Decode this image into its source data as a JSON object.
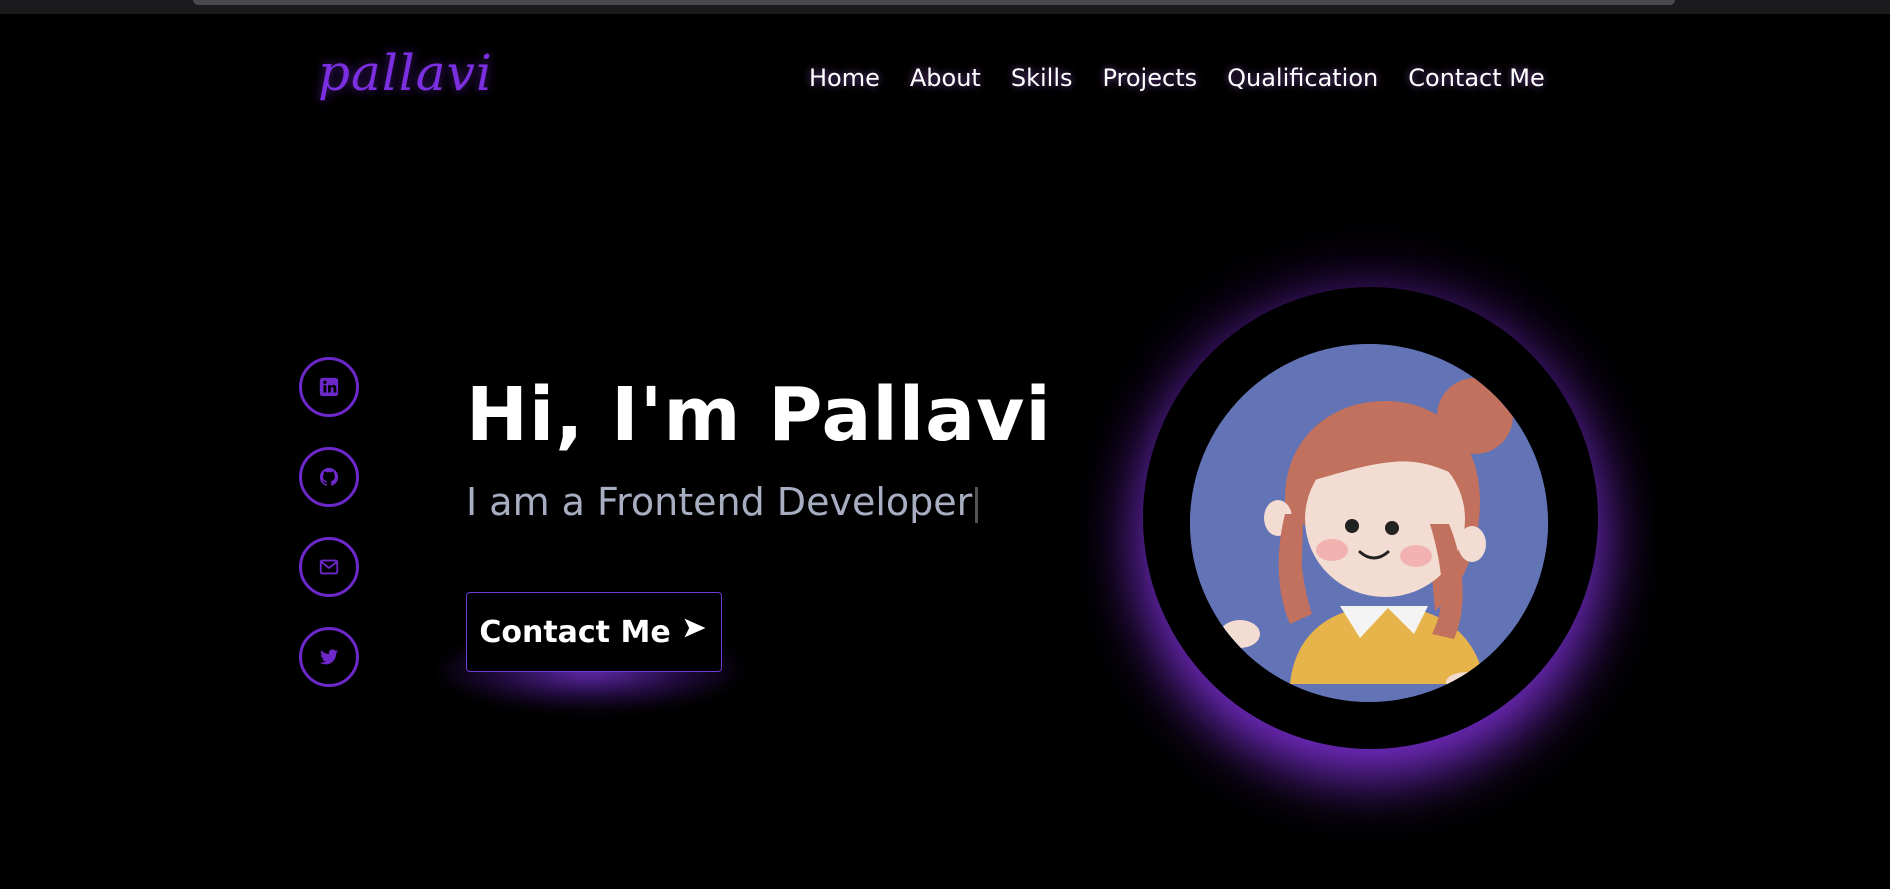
{
  "brand": {
    "logo_text": "pallavi",
    "accent_color": "#6d28c9"
  },
  "nav": {
    "items": [
      {
        "label": "Home"
      },
      {
        "label": "About"
      },
      {
        "label": "Skills"
      },
      {
        "label": "Projects"
      },
      {
        "label": "Qualification"
      },
      {
        "label": "Contact Me"
      }
    ]
  },
  "social": {
    "links": [
      {
        "icon": "linkedin-icon"
      },
      {
        "icon": "github-icon"
      },
      {
        "icon": "mail-icon"
      },
      {
        "icon": "twitter-icon"
      }
    ]
  },
  "hero": {
    "title": "Hi, I'm Pallavi",
    "subtitle": "I am a Frontend Developer",
    "cta_label": "Contact Me",
    "cta_icon": "arrow-right-icon"
  },
  "avatar": {
    "icon": "avatar-illustration"
  }
}
